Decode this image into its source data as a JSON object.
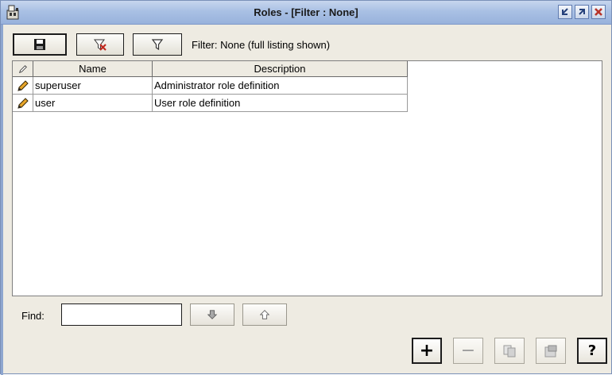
{
  "window": {
    "title": "Roles - [Filter : None]",
    "title_buttons": [
      "minimize-icon",
      "maximize-icon",
      "close-icon"
    ]
  },
  "toolbar": {
    "save_icon": "floppy-disk-icon",
    "clear_filter_icon": "funnel-x-icon",
    "filter_icon": "funnel-icon",
    "filter_status": "Filter: None (full listing shown)"
  },
  "table": {
    "columns": [
      "",
      "Name",
      "Description"
    ],
    "rows": [
      {
        "icon": "pencil-icon",
        "name": "superuser",
        "description": "Administrator role definition"
      },
      {
        "icon": "pencil-icon",
        "name": "user",
        "description": "User role definition"
      }
    ]
  },
  "find": {
    "label": "Find:",
    "value": "",
    "down_icon": "arrow-down-icon",
    "up_icon": "arrow-up-icon"
  },
  "actions": {
    "add_label": "+",
    "remove_label": "−",
    "copy_icon": "copy-icon",
    "properties_icon": "properties-icon",
    "help_label": "?"
  },
  "colors": {
    "window_bg": "#eeebe2",
    "titlebar": "#a9c0e4",
    "close_button": "#b8342a"
  }
}
